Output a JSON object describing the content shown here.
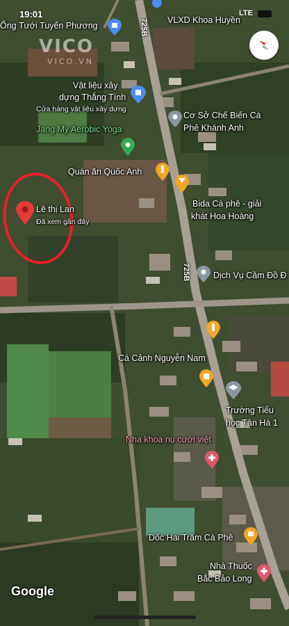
{
  "status_bar": {
    "time": "19:01",
    "network": "LTE"
  },
  "watermark": {
    "brand": "VICO",
    "site": "VICO.VN"
  },
  "road": {
    "name": "725B"
  },
  "places": {
    "ong_tuoi": "Ống Tưới Tuyển Phương",
    "vlxd": "VLXD Khoa Huyền",
    "vat_lieu_1": "Vật liệu xây",
    "vat_lieu_2": "dựng Thắng Tình",
    "vat_lieu_sub": "Cửa hàng vật liệu xây dựng",
    "co_so_1": "Cơ Sở Chế Biến Cà",
    "co_so_2": "Phê Khánh Anh",
    "yoga": "Jang My Aerobic Yoga",
    "quan_an": "Quán ăn Quốc Anh",
    "bida_1": "Bida Cà phê - giải",
    "bida_2": "khát Hoa Hoàng",
    "le_thi_lan": "Lê thị Lan",
    "le_thi_lan_sub": "Đã xem gần đây",
    "dich_vu": "Dịch Vụ Cầm Đồ Đ",
    "ca_canh": "Cá Cảnh Nguyễn Nam",
    "truong_1": "Trường Tiểu",
    "truong_2": "học Tân Hà 1",
    "nha_khoa": "Nha khoa nụ cười việt",
    "doc_hai_tram": "Dốc Hai Trăm Cà Phê",
    "nha_thuoc_1": "Nhà Thuốc",
    "nha_thuoc_2": "Bắc Bảo Long"
  },
  "attribution": "Google",
  "colors": {
    "pin_red": "#e53935",
    "food_orange": "#f5a623",
    "shop_blue": "#4a8df6",
    "green_pin": "#34a853",
    "grey_pin": "#8c96a0",
    "annotation_circle": "#e8202a",
    "health_red": "#e0566a"
  },
  "icons": [
    "compass-icon",
    "bag-icon",
    "fork-knife-icon",
    "glass-icon",
    "school-icon",
    "medical-icon",
    "place-icon",
    "signal-icon",
    "battery-icon"
  ]
}
